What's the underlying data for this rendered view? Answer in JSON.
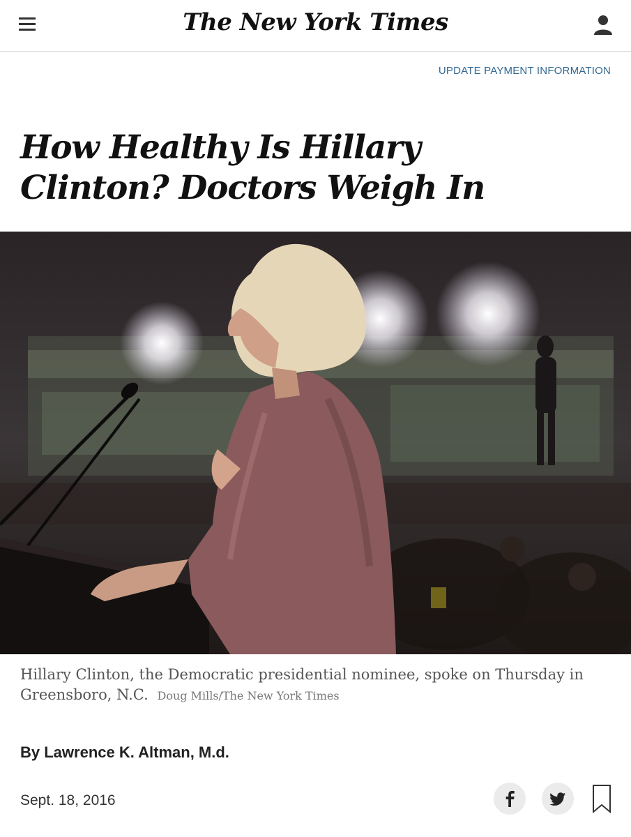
{
  "header": {
    "logo_text": "The New York Times",
    "menu_icon": "hamburger-menu-icon",
    "account_icon": "user-account-icon"
  },
  "top_link": {
    "label": "UPDATE PAYMENT INFORMATION"
  },
  "article": {
    "headline": "How Healthy Is Hillary Clinton? Doctors Weigh In",
    "caption": "Hillary Clinton, the Democratic presidential nominee, spoke on Thursday in Greensboro, N.C.",
    "photo_credit": "Doug Mills/The New York Times",
    "byline": "By Lawrence K. Altman, M.d.",
    "date": "Sept. 18, 2016"
  },
  "share": {
    "facebook_icon": "facebook-icon",
    "twitter_icon": "twitter-icon",
    "bookmark_icon": "bookmark-icon"
  },
  "colors": {
    "link": "#326891",
    "text": "#111111",
    "caption": "#555555",
    "share_bg": "#ebebeb"
  }
}
